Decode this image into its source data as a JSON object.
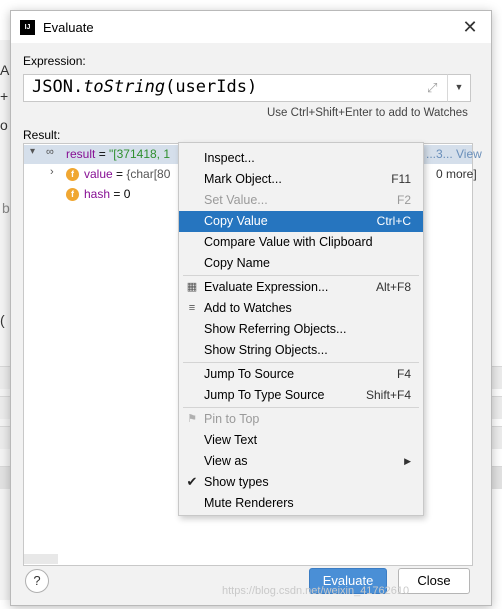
{
  "dialog": {
    "title": "Evaluate",
    "app_icon_text": "IJ",
    "expression_label": "Expression:",
    "expression": {
      "prefix": "JSON.",
      "method": "toString",
      "args": "(userIds)"
    },
    "hint": "Use Ctrl+Shift+Enter to add to Watches",
    "result_label": "Result:"
  },
  "result_tree": {
    "row1": {
      "name": "result",
      "value": "\"[371418, 1",
      "tail": "...3... View"
    },
    "row2": {
      "name": "value",
      "value": "{char[80",
      "tail": "0 more]"
    },
    "row3": {
      "name": "hash",
      "value": "= 0"
    }
  },
  "context_menu": {
    "items": [
      {
        "label": "Inspect...",
        "shortcut": ""
      },
      {
        "label": "Mark Object...",
        "shortcut": "F11"
      },
      {
        "label": "Set Value...",
        "shortcut": "F2",
        "disabled": true
      },
      {
        "label": "Copy Value",
        "shortcut": "Ctrl+C",
        "selected": true
      },
      {
        "label": "Compare Value with Clipboard",
        "shortcut": ""
      },
      {
        "label": "Copy Name",
        "shortcut": ""
      },
      {
        "label": "Evaluate Expression...",
        "shortcut": "Alt+F8",
        "icon": "calculator-icon"
      },
      {
        "label": "Add to Watches",
        "shortcut": "",
        "icon": "watches-icon"
      },
      {
        "label": "Show Referring Objects...",
        "shortcut": ""
      },
      {
        "label": "Show String Objects...",
        "shortcut": ""
      },
      {
        "label": "Jump To Source",
        "shortcut": "F4"
      },
      {
        "label": "Jump To Type Source",
        "shortcut": "Shift+F4"
      },
      {
        "label": "Pin to Top",
        "shortcut": "",
        "disabled": true,
        "icon": "pin-icon"
      },
      {
        "label": "View Text",
        "shortcut": ""
      },
      {
        "label": "View as",
        "shortcut": "",
        "submenu": true
      },
      {
        "label": "Show types",
        "shortcut": "",
        "checked": true
      },
      {
        "label": "Mute Renderers",
        "shortcut": ""
      }
    ]
  },
  "buttons": {
    "help": "?",
    "evaluate": "Evaluate",
    "close": "Close"
  },
  "watermark": "https://blog.csdn.net/weixin_41762610",
  "background_chars": {
    "a": "A",
    "plus": "+",
    "o": "o",
    "paren": "(",
    "b": "b"
  },
  "colors": {
    "accent": "#2675bf",
    "primary_button": "#4a8fd6",
    "field_badge": "#f0a732",
    "result_name": "#871094",
    "result_value": "#2f8f2f"
  }
}
